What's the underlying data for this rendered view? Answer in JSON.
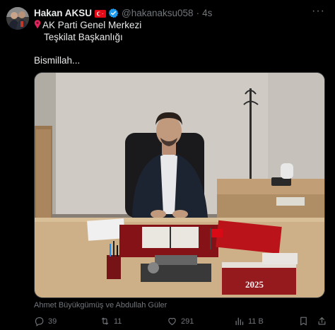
{
  "post": {
    "author_name": "Hakan AKSU",
    "handle": "@hakanaksu058",
    "separator": "·",
    "time": "4s",
    "more_label": "···",
    "location_line1": "AK Parti Genel Merkezi",
    "location_line2": "Teşkilat Başkanlığı",
    "text": "Bismillah..."
  },
  "photo": {
    "caption": "Ahmet Büyükgümüş ve Abdullah Güler",
    "calendar_year": "2025"
  },
  "actions": {
    "replies": "39",
    "reposts": "11",
    "likes": "291",
    "views": "11 B"
  },
  "colors": {
    "background": "#000000",
    "text": "#e7e9ea",
    "muted": "#71767b",
    "verified": "#1d9bf0",
    "flag_red": "#e30a17"
  },
  "icons": [
    "turkey-flag-icon",
    "verified-badge-icon",
    "pin-icon",
    "more-icon",
    "reply-icon",
    "repost-icon",
    "like-icon",
    "views-icon",
    "bookmark-icon",
    "share-icon"
  ]
}
